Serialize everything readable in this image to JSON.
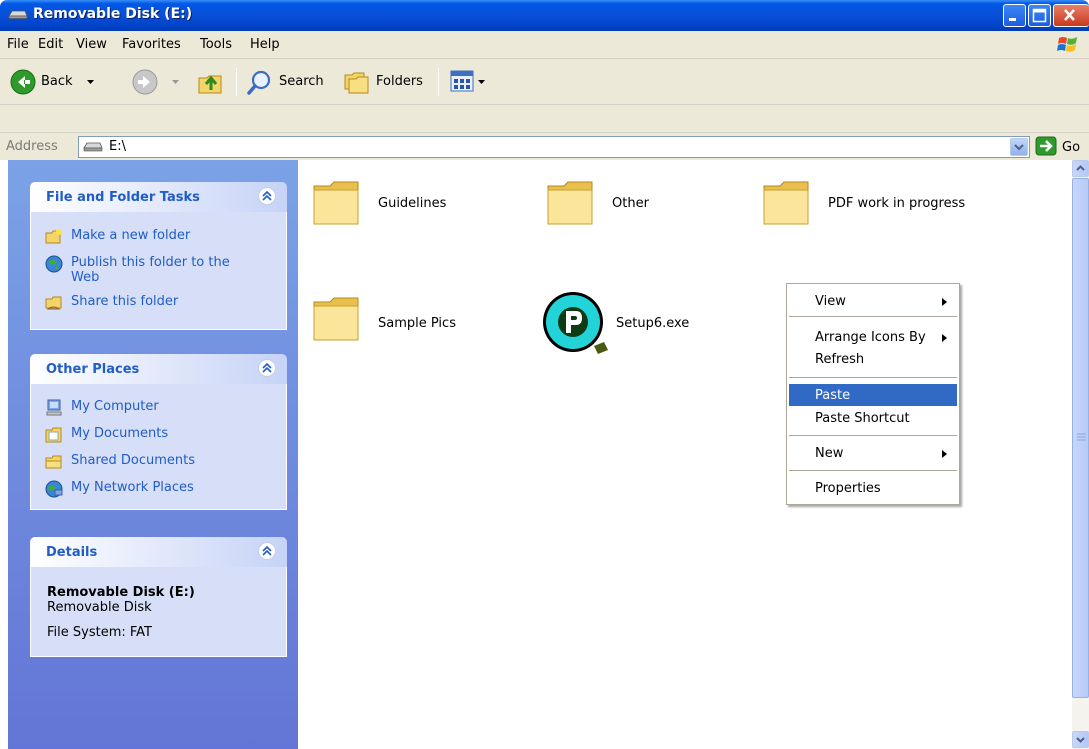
{
  "window": {
    "title": "Removable Disk (E:)",
    "title_icon": "drive-icon"
  },
  "menubar": {
    "items": [
      "File",
      "Edit",
      "View",
      "Favorites",
      "Tools",
      "Help"
    ]
  },
  "toolbar": {
    "back_label": "Back",
    "search_label": "Search",
    "folders_label": "Folders"
  },
  "address": {
    "label": "Address",
    "value": "E:\\",
    "go_label": "Go"
  },
  "tasks_panel": {
    "file_folder_tasks": {
      "title": "File and Folder Tasks",
      "items": [
        {
          "label": "Make a new folder",
          "icon": "new-folder-icon"
        },
        {
          "label": "Publish this folder to the Web",
          "icon": "publish-web-icon"
        },
        {
          "label": "Share this folder",
          "icon": "share-folder-icon"
        }
      ]
    },
    "other_places": {
      "title": "Other Places",
      "items": [
        {
          "label": "My Computer",
          "icon": "my-computer-icon"
        },
        {
          "label": "My Documents",
          "icon": "my-documents-icon"
        },
        {
          "label": "Shared Documents",
          "icon": "shared-documents-icon"
        },
        {
          "label": "My Network Places",
          "icon": "network-places-icon"
        }
      ]
    },
    "details": {
      "title": "Details",
      "name": "Removable Disk (E:)",
      "type": "Removable Disk",
      "filesystem": "File System: FAT"
    }
  },
  "files": [
    {
      "label": "Guidelines",
      "icon": "folder-icon"
    },
    {
      "label": "Other",
      "icon": "folder-icon"
    },
    {
      "label": "PDF work in progress",
      "icon": "folder-icon"
    },
    {
      "label": "Sample Pics",
      "icon": "folder-icon"
    },
    {
      "label": "Setup6.exe",
      "icon": "setup-exe-icon"
    }
  ],
  "context_menu": {
    "items": [
      {
        "label": "View",
        "submenu": true
      },
      {
        "label": "Arrange Icons By",
        "submenu": true
      },
      {
        "label": "Refresh",
        "submenu": false
      },
      {
        "label": "Paste",
        "submenu": false,
        "selected": true
      },
      {
        "label": "Paste Shortcut",
        "submenu": false
      },
      {
        "label": "New",
        "submenu": true
      },
      {
        "label": "Properties",
        "submenu": false
      }
    ]
  },
  "colors": {
    "title_bar": "#0a4fd8",
    "task_pane_bg": "#7ba2e7",
    "panel_body": "#d6dff7",
    "link_blue": "#215dc6",
    "menu_selection": "#316ac5"
  }
}
